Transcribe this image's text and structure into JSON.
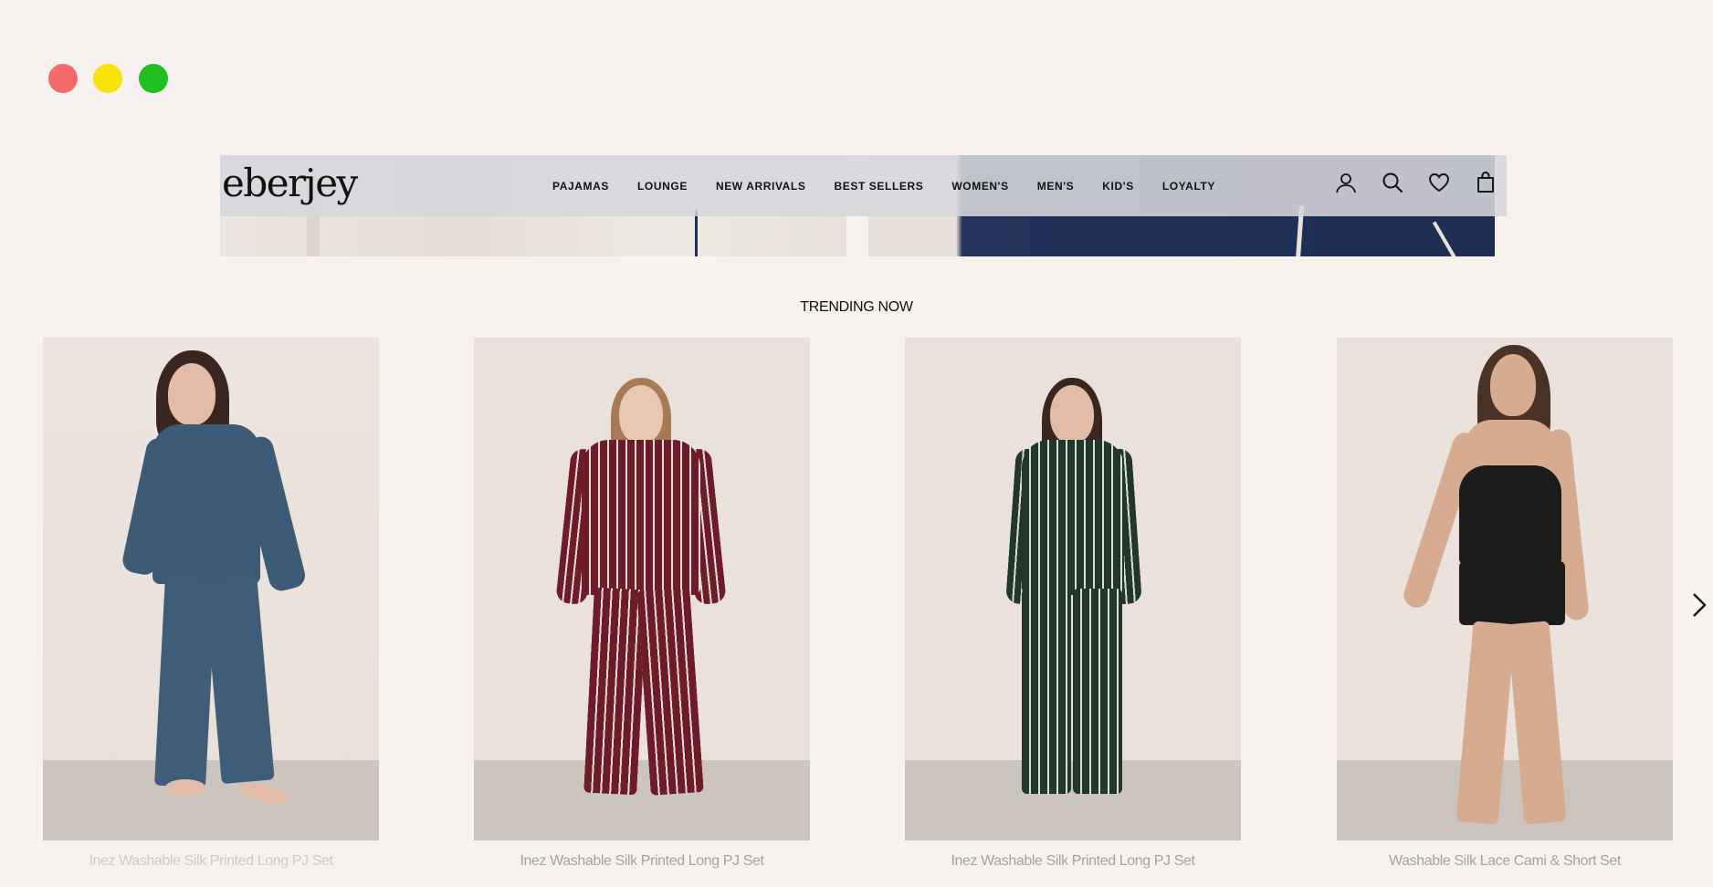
{
  "window": {
    "controls": [
      "close",
      "minimize",
      "maximize"
    ],
    "colors": {
      "close": "#f36b6b",
      "minimize": "#f7e20a",
      "maximize": "#1fc01f"
    }
  },
  "header": {
    "logo": "eberjey",
    "nav": [
      "PAJAMAS",
      "LOUNGE",
      "NEW ARRIVALS",
      "BEST SELLERS",
      "WOMEN'S",
      "MEN'S",
      "KID'S",
      "LOYALTY"
    ],
    "icons": [
      "account-icon",
      "search-icon",
      "heart-icon",
      "shopping-bag-icon"
    ]
  },
  "trending": {
    "title": "TRENDING NOW",
    "products": [
      {
        "name": "Inez Washable Silk Printed Long PJ Set",
        "color": "#3d5a76"
      },
      {
        "name": "Inez Washable Silk Printed Long PJ Set",
        "color": "#6e1c2a"
      },
      {
        "name": "Inez Washable Silk Printed Long PJ Set",
        "color": "#23362c"
      },
      {
        "name": "Washable Silk Lace Cami & Short Set",
        "color": "#1b1b1b"
      }
    ],
    "next_icon": "chevron-right-icon"
  }
}
